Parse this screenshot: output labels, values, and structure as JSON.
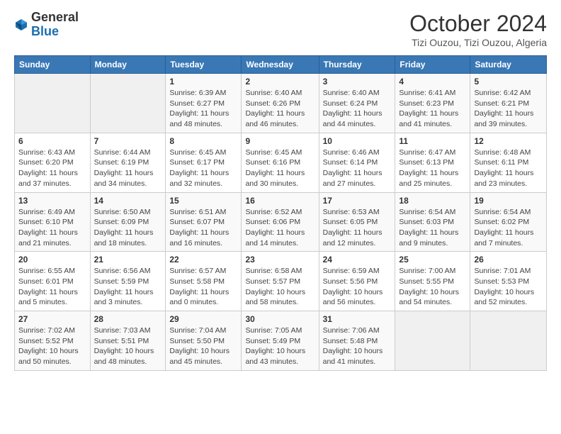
{
  "header": {
    "logo_general": "General",
    "logo_blue": "Blue",
    "month": "October 2024",
    "location": "Tizi Ouzou, Tizi Ouzou, Algeria"
  },
  "weekdays": [
    "Sunday",
    "Monday",
    "Tuesday",
    "Wednesday",
    "Thursday",
    "Friday",
    "Saturday"
  ],
  "weeks": [
    [
      {
        "day": null
      },
      {
        "day": null
      },
      {
        "day": "1",
        "sunrise": "Sunrise: 6:39 AM",
        "sunset": "Sunset: 6:27 PM",
        "daylight": "Daylight: 11 hours and 48 minutes."
      },
      {
        "day": "2",
        "sunrise": "Sunrise: 6:40 AM",
        "sunset": "Sunset: 6:26 PM",
        "daylight": "Daylight: 11 hours and 46 minutes."
      },
      {
        "day": "3",
        "sunrise": "Sunrise: 6:40 AM",
        "sunset": "Sunset: 6:24 PM",
        "daylight": "Daylight: 11 hours and 44 minutes."
      },
      {
        "day": "4",
        "sunrise": "Sunrise: 6:41 AM",
        "sunset": "Sunset: 6:23 PM",
        "daylight": "Daylight: 11 hours and 41 minutes."
      },
      {
        "day": "5",
        "sunrise": "Sunrise: 6:42 AM",
        "sunset": "Sunset: 6:21 PM",
        "daylight": "Daylight: 11 hours and 39 minutes."
      }
    ],
    [
      {
        "day": "6",
        "sunrise": "Sunrise: 6:43 AM",
        "sunset": "Sunset: 6:20 PM",
        "daylight": "Daylight: 11 hours and 37 minutes."
      },
      {
        "day": "7",
        "sunrise": "Sunrise: 6:44 AM",
        "sunset": "Sunset: 6:19 PM",
        "daylight": "Daylight: 11 hours and 34 minutes."
      },
      {
        "day": "8",
        "sunrise": "Sunrise: 6:45 AM",
        "sunset": "Sunset: 6:17 PM",
        "daylight": "Daylight: 11 hours and 32 minutes."
      },
      {
        "day": "9",
        "sunrise": "Sunrise: 6:45 AM",
        "sunset": "Sunset: 6:16 PM",
        "daylight": "Daylight: 11 hours and 30 minutes."
      },
      {
        "day": "10",
        "sunrise": "Sunrise: 6:46 AM",
        "sunset": "Sunset: 6:14 PM",
        "daylight": "Daylight: 11 hours and 27 minutes."
      },
      {
        "day": "11",
        "sunrise": "Sunrise: 6:47 AM",
        "sunset": "Sunset: 6:13 PM",
        "daylight": "Daylight: 11 hours and 25 minutes."
      },
      {
        "day": "12",
        "sunrise": "Sunrise: 6:48 AM",
        "sunset": "Sunset: 6:11 PM",
        "daylight": "Daylight: 11 hours and 23 minutes."
      }
    ],
    [
      {
        "day": "13",
        "sunrise": "Sunrise: 6:49 AM",
        "sunset": "Sunset: 6:10 PM",
        "daylight": "Daylight: 11 hours and 21 minutes."
      },
      {
        "day": "14",
        "sunrise": "Sunrise: 6:50 AM",
        "sunset": "Sunset: 6:09 PM",
        "daylight": "Daylight: 11 hours and 18 minutes."
      },
      {
        "day": "15",
        "sunrise": "Sunrise: 6:51 AM",
        "sunset": "Sunset: 6:07 PM",
        "daylight": "Daylight: 11 hours and 16 minutes."
      },
      {
        "day": "16",
        "sunrise": "Sunrise: 6:52 AM",
        "sunset": "Sunset: 6:06 PM",
        "daylight": "Daylight: 11 hours and 14 minutes."
      },
      {
        "day": "17",
        "sunrise": "Sunrise: 6:53 AM",
        "sunset": "Sunset: 6:05 PM",
        "daylight": "Daylight: 11 hours and 12 minutes."
      },
      {
        "day": "18",
        "sunrise": "Sunrise: 6:54 AM",
        "sunset": "Sunset: 6:03 PM",
        "daylight": "Daylight: 11 hours and 9 minutes."
      },
      {
        "day": "19",
        "sunrise": "Sunrise: 6:54 AM",
        "sunset": "Sunset: 6:02 PM",
        "daylight": "Daylight: 11 hours and 7 minutes."
      }
    ],
    [
      {
        "day": "20",
        "sunrise": "Sunrise: 6:55 AM",
        "sunset": "Sunset: 6:01 PM",
        "daylight": "Daylight: 11 hours and 5 minutes."
      },
      {
        "day": "21",
        "sunrise": "Sunrise: 6:56 AM",
        "sunset": "Sunset: 5:59 PM",
        "daylight": "Daylight: 11 hours and 3 minutes."
      },
      {
        "day": "22",
        "sunrise": "Sunrise: 6:57 AM",
        "sunset": "Sunset: 5:58 PM",
        "daylight": "Daylight: 11 hours and 0 minutes."
      },
      {
        "day": "23",
        "sunrise": "Sunrise: 6:58 AM",
        "sunset": "Sunset: 5:57 PM",
        "daylight": "Daylight: 10 hours and 58 minutes."
      },
      {
        "day": "24",
        "sunrise": "Sunrise: 6:59 AM",
        "sunset": "Sunset: 5:56 PM",
        "daylight": "Daylight: 10 hours and 56 minutes."
      },
      {
        "day": "25",
        "sunrise": "Sunrise: 7:00 AM",
        "sunset": "Sunset: 5:55 PM",
        "daylight": "Daylight: 10 hours and 54 minutes."
      },
      {
        "day": "26",
        "sunrise": "Sunrise: 7:01 AM",
        "sunset": "Sunset: 5:53 PM",
        "daylight": "Daylight: 10 hours and 52 minutes."
      }
    ],
    [
      {
        "day": "27",
        "sunrise": "Sunrise: 7:02 AM",
        "sunset": "Sunset: 5:52 PM",
        "daylight": "Daylight: 10 hours and 50 minutes."
      },
      {
        "day": "28",
        "sunrise": "Sunrise: 7:03 AM",
        "sunset": "Sunset: 5:51 PM",
        "daylight": "Daylight: 10 hours and 48 minutes."
      },
      {
        "day": "29",
        "sunrise": "Sunrise: 7:04 AM",
        "sunset": "Sunset: 5:50 PM",
        "daylight": "Daylight: 10 hours and 45 minutes."
      },
      {
        "day": "30",
        "sunrise": "Sunrise: 7:05 AM",
        "sunset": "Sunset: 5:49 PM",
        "daylight": "Daylight: 10 hours and 43 minutes."
      },
      {
        "day": "31",
        "sunrise": "Sunrise: 7:06 AM",
        "sunset": "Sunset: 5:48 PM",
        "daylight": "Daylight: 10 hours and 41 minutes."
      },
      {
        "day": null
      },
      {
        "day": null
      }
    ]
  ]
}
